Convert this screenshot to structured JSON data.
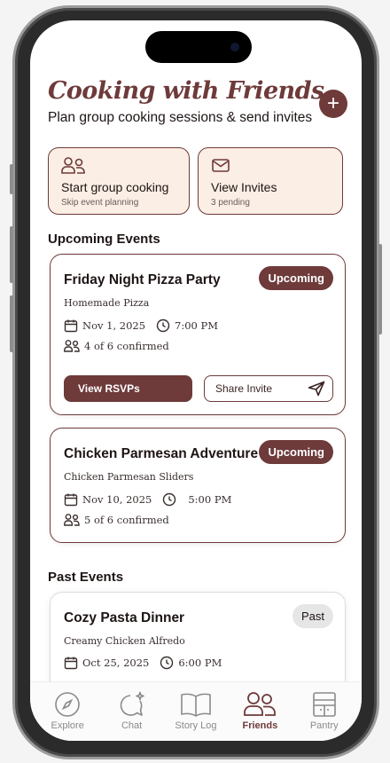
{
  "header": {
    "title": "Cooking with Friends",
    "subtitle": "Plan group cooking sessions & send invites",
    "add_label": "+"
  },
  "quick_actions": [
    {
      "label": "Start group cooking",
      "sub": "Skip event planning",
      "icon": "group-icon"
    },
    {
      "label": "View Invites",
      "sub": "3 pending",
      "icon": "mail-icon"
    }
  ],
  "upcoming": {
    "title": "Upcoming Events",
    "events": [
      {
        "title": "Friday Night Pizza Party",
        "status": "Upcoming",
        "recipe": "Homemade Pizza",
        "date": "Nov 1, 2025",
        "time": "7:00 PM",
        "confirmed": "4 of 6 confirmed",
        "primary_action": "View RSVPs",
        "secondary_action": "Share Invite"
      },
      {
        "title": "Chicken Parmesan Adventure",
        "status": "Upcoming",
        "recipe": "Chicken Parmesan Sliders",
        "date": "Nov 10, 2025",
        "time": "5:00 PM",
        "confirmed": "5 of 6 confirmed"
      }
    ]
  },
  "past": {
    "title": "Past Events",
    "events": [
      {
        "title": "Cozy Pasta Dinner",
        "status": "Past",
        "recipe": "Creamy Chicken Alfredo",
        "date": "Oct 25, 2025",
        "time": "6:00 PM"
      }
    ]
  },
  "nav": {
    "active": "Friends",
    "items": [
      {
        "label": "Explore",
        "icon": "compass-icon"
      },
      {
        "label": "Chat",
        "icon": "chat-sparkle-icon"
      },
      {
        "label": "Story Log",
        "icon": "book-icon"
      },
      {
        "label": "Friends",
        "icon": "friends-icon"
      },
      {
        "label": "Pantry",
        "icon": "pantry-icon"
      }
    ]
  },
  "colors": {
    "brand": "#6e3a3a",
    "quick_action_bg": "#fbeee4",
    "past_badge_bg": "#e6e6e6"
  }
}
